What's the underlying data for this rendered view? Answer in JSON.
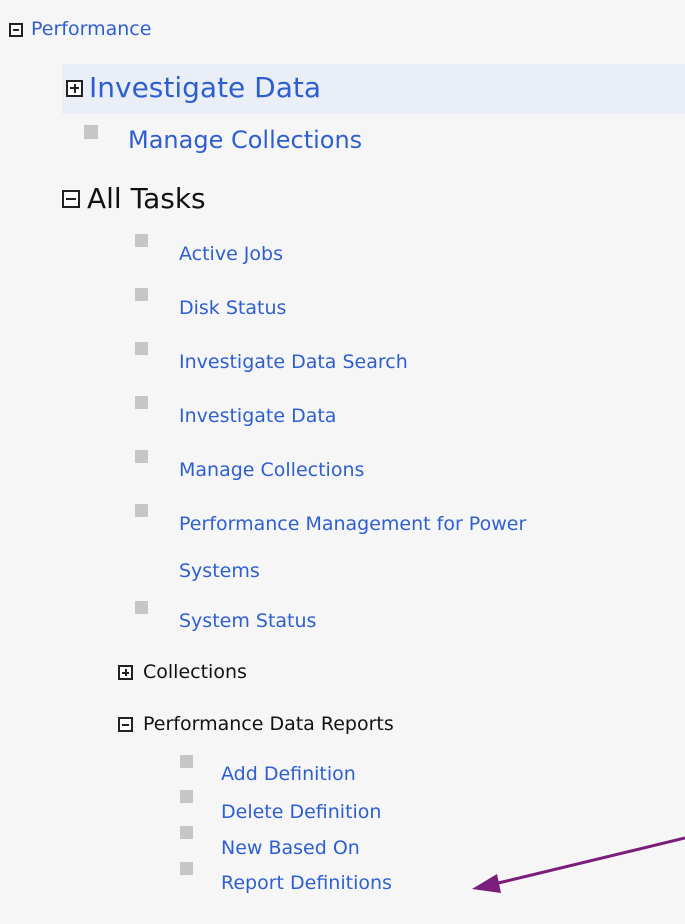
{
  "tree": {
    "root": {
      "label": "Performance",
      "state": "expanded"
    },
    "investigate": {
      "label": "Investigate Data",
      "state": "collapsed"
    },
    "manage": {
      "label": "Manage Collections"
    },
    "all_tasks": {
      "label": "All Tasks",
      "state": "expanded",
      "items": [
        {
          "label": "Active Jobs"
        },
        {
          "label": "Disk Status"
        },
        {
          "label": "Investigate Data Search"
        },
        {
          "label": "Investigate Data"
        },
        {
          "label": "Manage Collections"
        },
        {
          "label_line1": "Performance Management for Power",
          "label_line2": "Systems"
        },
        {
          "label": "System Status"
        }
      ]
    },
    "collections": {
      "label": "Collections",
      "state": "collapsed"
    },
    "reports": {
      "label": "Performance Data Reports",
      "state": "expanded",
      "items": [
        {
          "label": "Add Definition"
        },
        {
          "label": "Delete Definition"
        },
        {
          "label": "New Based On"
        },
        {
          "label": "Report Definitions"
        }
      ]
    }
  },
  "colors": {
    "link": "#2e5fd0",
    "text": "#111111",
    "bullet": "#c6c6c6",
    "highlight": "#e9eef7",
    "annotation_arrow": "#7b1e7b"
  }
}
